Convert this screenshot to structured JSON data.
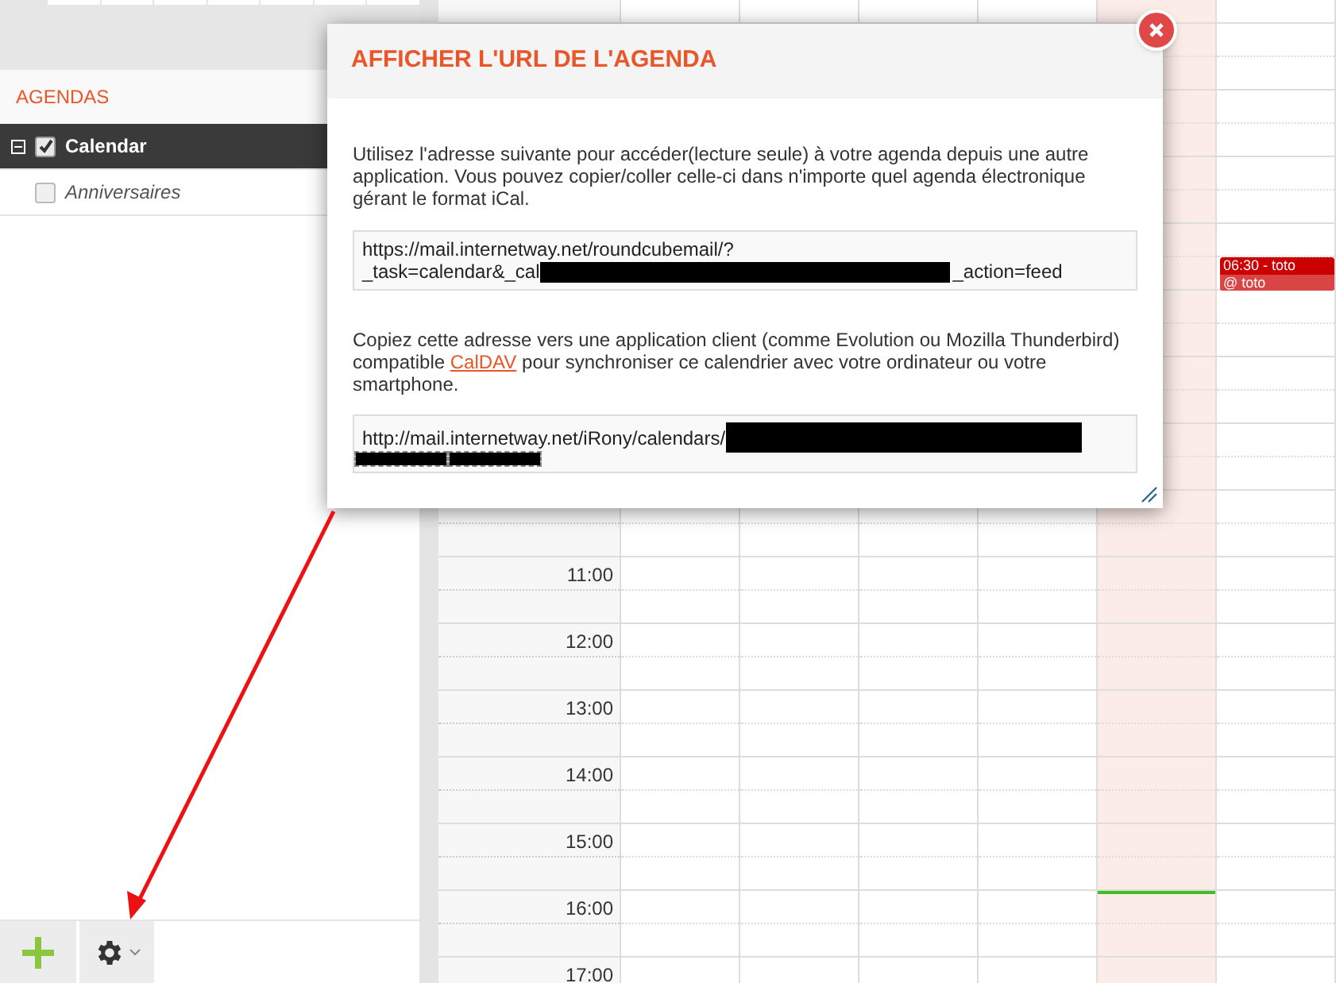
{
  "sidebar": {
    "section_title": "AGENDAS",
    "calendars": [
      {
        "name": "Calendar",
        "checked": true,
        "selected": true
      },
      {
        "name": "Anniversaires",
        "checked": false,
        "selected": false
      }
    ]
  },
  "calendar": {
    "hours": [
      "11:00",
      "12:00",
      "13:00",
      "14:00",
      "15:00",
      "16:00",
      "17:00"
    ],
    "event": {
      "title": "06:30 - toto",
      "location": "@ toto"
    }
  },
  "dialog": {
    "title": "AFFICHER L'URL DE L'AGENDA",
    "intro": "Utilisez l'adresse suivante pour accéder(lecture seule) à votre agenda depuis une autre application. Vous pouvez copier/coller celle-ci dans n'importe quel agenda électronique gérant le format iCal.",
    "ical_url": {
      "line_1": "https://mail.internetway.net/roundcubemail/?",
      "line_2_start": "_task=calendar&_cal",
      "line_2_end": "_action=feed"
    },
    "caldav_before": "Copiez cette adresse vers une application client (comme Evolution ou Mozilla Thunderbird) compatible",
    "caldav_link": "CalDAV",
    "caldav_after": "pour synchroniser ce calendrier avec votre ordinateur ou votre smartphone.",
    "caldav_url": "http://mail.internetway.net/iRony/calendars/"
  }
}
